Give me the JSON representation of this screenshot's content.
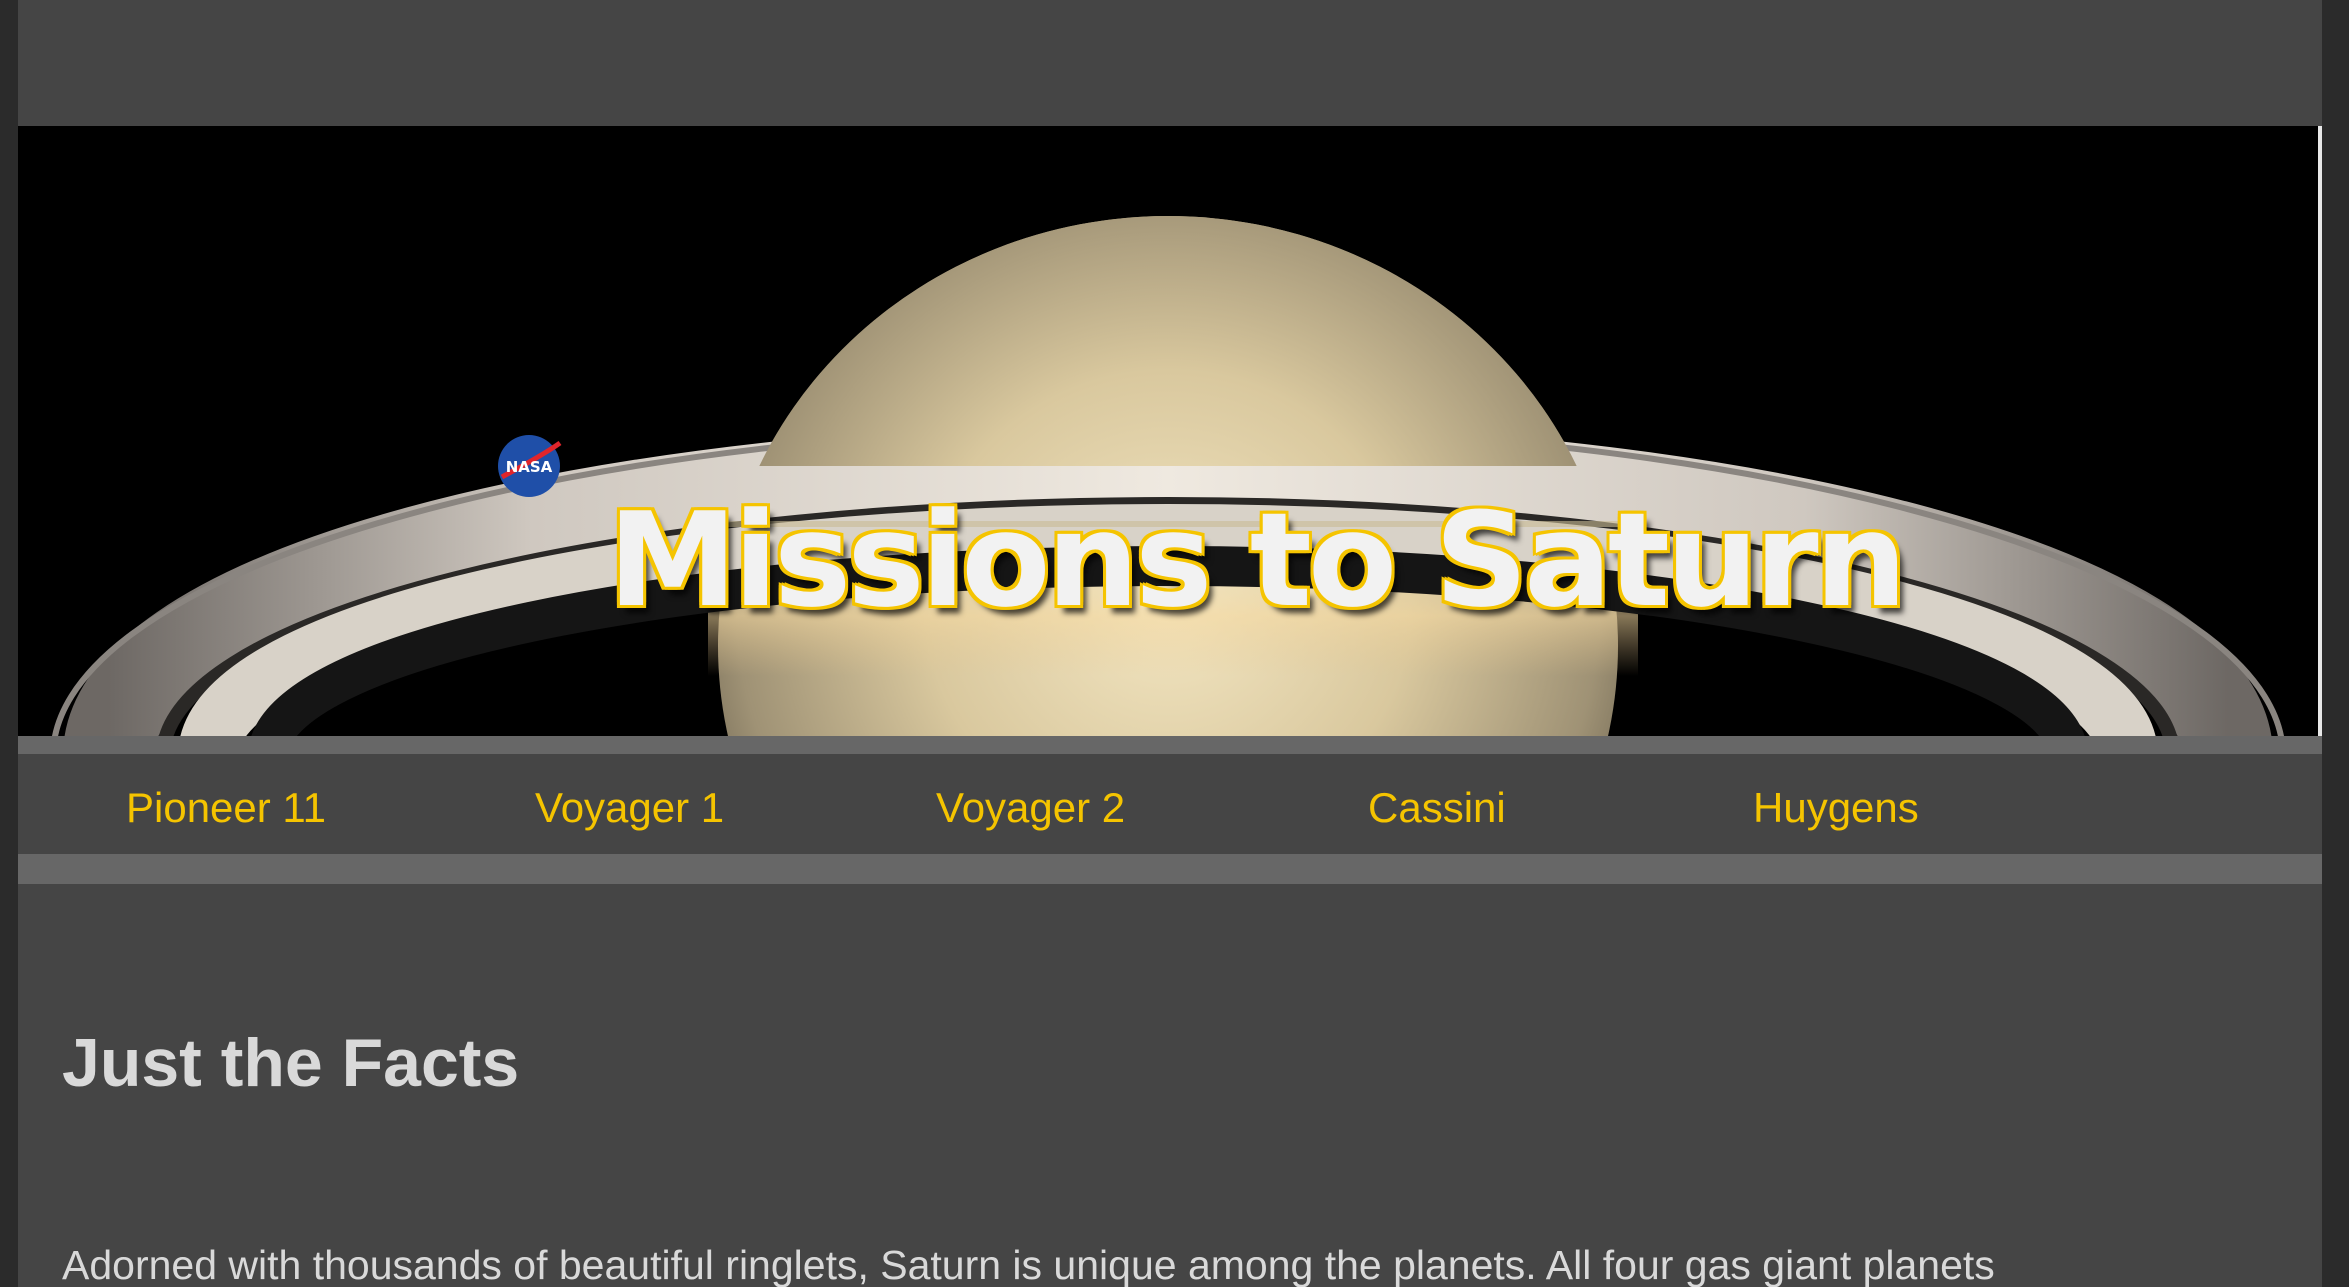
{
  "header": {
    "title": "Missions to Saturn",
    "logo_icon": "nasa-logo-icon",
    "logo_text": "NASA",
    "title_color": "#f2f2f2",
    "title_outline_color": "#f5c400"
  },
  "nav": {
    "items": [
      {
        "label": "Pioneer 11"
      },
      {
        "label": "Voyager 1"
      },
      {
        "label": "Voyager 2"
      },
      {
        "label": "Cassini"
      },
      {
        "label": "Huygens"
      }
    ],
    "link_color": "#f5c400"
  },
  "main": {
    "heading": "Just the Facts",
    "intro": "Adorned with thousands of beautiful ringlets, Saturn is unique among the planets. All four gas giant planets"
  },
  "colors": {
    "page_bg": "#454545",
    "rule": "#676767",
    "outer_bg": "#2b2b2b",
    "text": "#d9d9d9"
  }
}
